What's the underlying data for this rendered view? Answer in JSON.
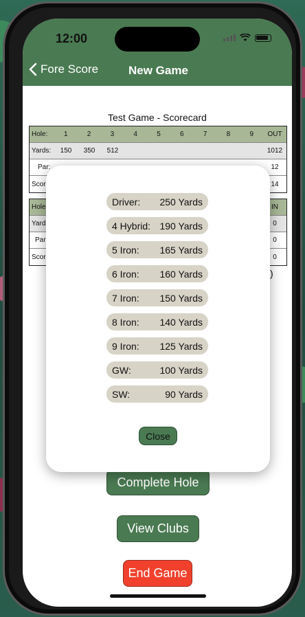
{
  "status": {
    "time": "12:00"
  },
  "nav": {
    "back_label": "Fore Score",
    "title": "New Game"
  },
  "scorecard": {
    "title": "Test Game - Scorecard",
    "front": {
      "hole_label": "Hole:",
      "holes": [
        "1",
        "2",
        "3",
        "4",
        "5",
        "6",
        "7",
        "8",
        "9"
      ],
      "out_label": "OUT",
      "yards_label": "Yards:",
      "yards": [
        "150",
        "350",
        "512",
        "",
        "",
        "",
        "",
        "",
        ""
      ],
      "yards_total": "1012",
      "par_label": "Par:",
      "par_total": "12",
      "score_label": "Score",
      "score_total": "14"
    },
    "back": {
      "hole_label": "Hole",
      "in_label": "IN",
      "yards_label": "Yards",
      "yards_total": "0",
      "par_label": "Par",
      "par_total": "0",
      "score_label": "Score",
      "score_total": "0"
    },
    "paren": ")"
  },
  "buttons": {
    "complete_hole": "Complete Hole",
    "view_clubs": "View Clubs",
    "end_game": "End Game"
  },
  "colors": {
    "accent": "#4a7a52",
    "danger": "#f1412d",
    "chip": "#d7d3c6",
    "table_header": "#a8b897"
  },
  "clubs_modal": {
    "clubs": [
      {
        "name": "Driver:",
        "distance": "250 Yards"
      },
      {
        "name": "4 Hybrid:",
        "distance": "190 Yards"
      },
      {
        "name": "5 Iron:",
        "distance": "165 Yards"
      },
      {
        "name": "6 Iron:",
        "distance": "160 Yards"
      },
      {
        "name": "7 Iron:",
        "distance": "150 Yards"
      },
      {
        "name": "8 Iron:",
        "distance": "140 Yards"
      },
      {
        "name": "9 Iron:",
        "distance": "125 Yards"
      },
      {
        "name": "GW:",
        "distance": "100 Yards"
      },
      {
        "name": "SW:",
        "distance": "90 Yards"
      }
    ],
    "close_label": "Close"
  }
}
